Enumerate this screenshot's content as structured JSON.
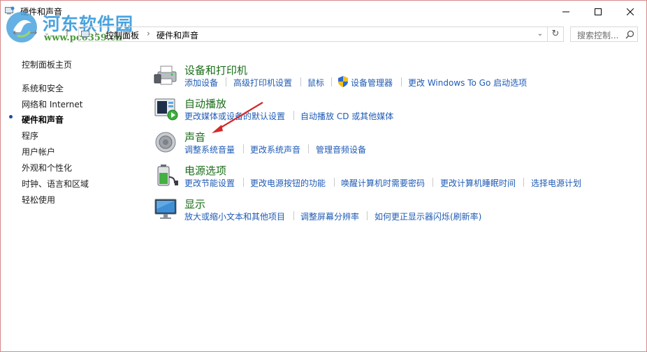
{
  "window": {
    "title": "硬件和声音"
  },
  "watermark": {
    "site_name": "河东软件园",
    "url": "www.pc0359.cn"
  },
  "address": {
    "crumbs": [
      "控制面板",
      "硬件和声音"
    ],
    "search_placeholder": "搜索控制..."
  },
  "sidebar": {
    "home": "控制面板主页",
    "items": [
      "系统和安全",
      "网络和 Internet",
      "硬件和声音",
      "程序",
      "用户帐户",
      "外观和个性化",
      "时钟、语言和区域",
      "轻松使用"
    ],
    "current_index": 2
  },
  "categories": [
    {
      "title": "设备和打印机",
      "icon": "printer-device-icon",
      "links": [
        "添加设备",
        "高级打印机设置",
        "鼠标",
        "设备管理器",
        "更改 Windows To Go 启动选项"
      ]
    },
    {
      "title": "自动播放",
      "icon": "autoplay-icon",
      "links": [
        "更改媒体或设备的默认设置",
        "自动播放 CD 或其他媒体"
      ]
    },
    {
      "title": "声音",
      "icon": "speaker-icon",
      "links": [
        "调整系统音量",
        "更改系统声音",
        "管理音频设备"
      ]
    },
    {
      "title": "电源选项",
      "icon": "battery-power-icon",
      "links": [
        "更改节能设置",
        "更改电源按钮的功能",
        "唤醒计算机时需要密码",
        "更改计算机睡眠时间",
        "选择电源计划"
      ]
    },
    {
      "title": "显示",
      "icon": "monitor-icon",
      "links": [
        "放大或缩小文本和其他项目",
        "调整屏幕分辨率",
        "如何更正显示器闪烁(刷新率)"
      ]
    }
  ],
  "colors": {
    "category_title": "#1a6e1a",
    "link": "#1f5bb5",
    "annotation_arrow": "#d42a2a",
    "watermark": "#4aa3df"
  }
}
